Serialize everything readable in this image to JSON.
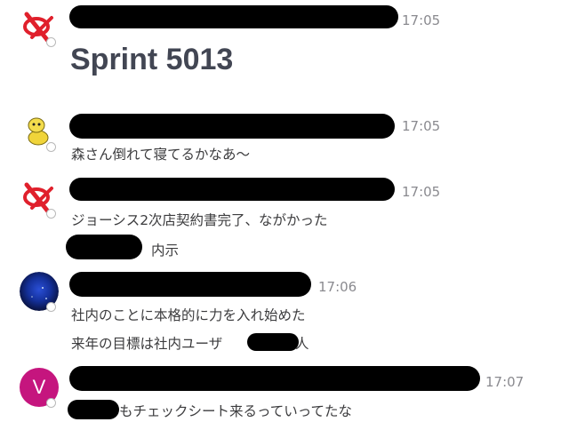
{
  "messages": [
    {
      "avatar_icon": "red-cancel-icon",
      "time": "17:05",
      "text": "Sprint 5013"
    },
    {
      "avatar_icon": "yellow-character-icon",
      "time": "17:05",
      "text": "森さん倒れて寝てるかなあ～"
    },
    {
      "avatar_icon": "red-cancel-icon",
      "time": "17:05",
      "lines": [
        "ジョーシス2次店契約書完了、ながかった",
        "内示"
      ]
    },
    {
      "avatar_icon": "space-photo-avatar",
      "time": "17:06",
      "lines": [
        "社内のことに本格的に力を入れ始めた",
        "来年の目標は社内ユーザ",
        "人"
      ]
    },
    {
      "avatar_letter": "V",
      "avatar_color": "#c5157e",
      "time": "17:07",
      "text": "もチェックシート来るっていってたな"
    }
  ],
  "colors": {
    "accent_red": "#e0202c",
    "avatar_magenta": "#c5157e"
  }
}
